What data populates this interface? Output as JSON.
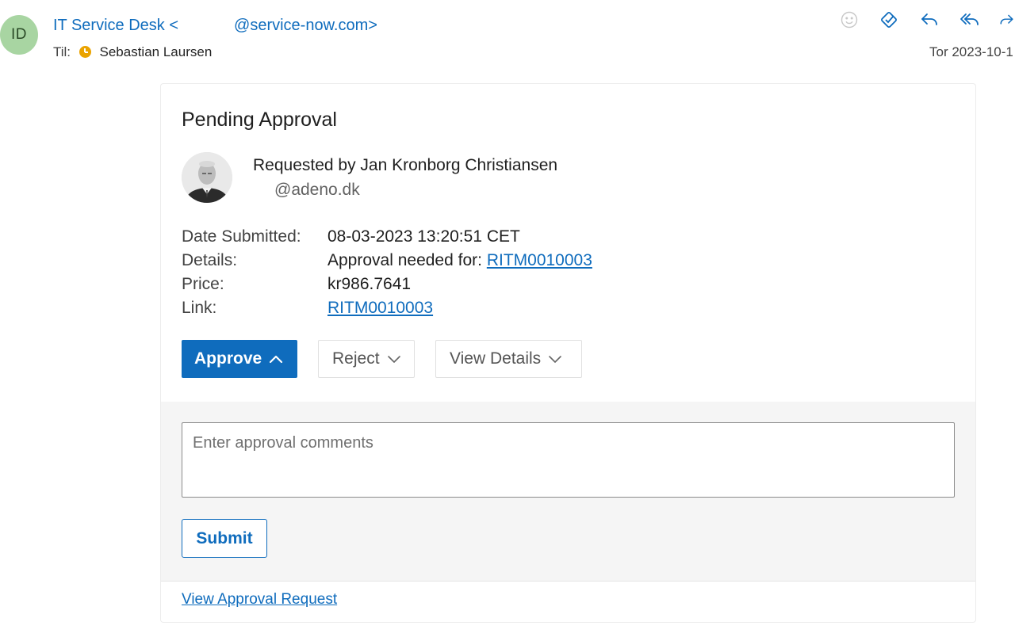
{
  "email": {
    "sender_initials": "ID",
    "sender_name": "IT Service Desk <",
    "sender_domain": "@service-now.com>",
    "to_label": "Til:",
    "to_name": "Sebastian Laursen",
    "date": "Tor 2023-10-1",
    "toolbar_icons": [
      "emoji-icon",
      "tag-icon",
      "reply-icon",
      "reply-all-icon",
      "forward-icon"
    ]
  },
  "card": {
    "title": "Pending Approval",
    "requested_by": "Requested by Jan Kronborg Christiansen",
    "requester_email": "@adeno.dk",
    "details": {
      "date_label": "Date Submitted:",
      "date_value": "08-03-2023 13:20:51 CET",
      "details_label": "Details:",
      "details_text": "Approval needed for: ",
      "details_link": "RITM0010003",
      "price_label": "Price:",
      "price_value": "kr986.7641",
      "link_label": "Link:",
      "link_value": "RITM0010003"
    },
    "buttons": {
      "approve": "Approve",
      "reject": "Reject",
      "view_details": "View Details"
    },
    "comment_placeholder": "Enter approval comments",
    "submit": "Submit",
    "view_request": "View Approval Request"
  },
  "colors": {
    "accent": "#0f6cbd",
    "avatar_bg": "#a8d5a2",
    "status": "#eaa300"
  }
}
